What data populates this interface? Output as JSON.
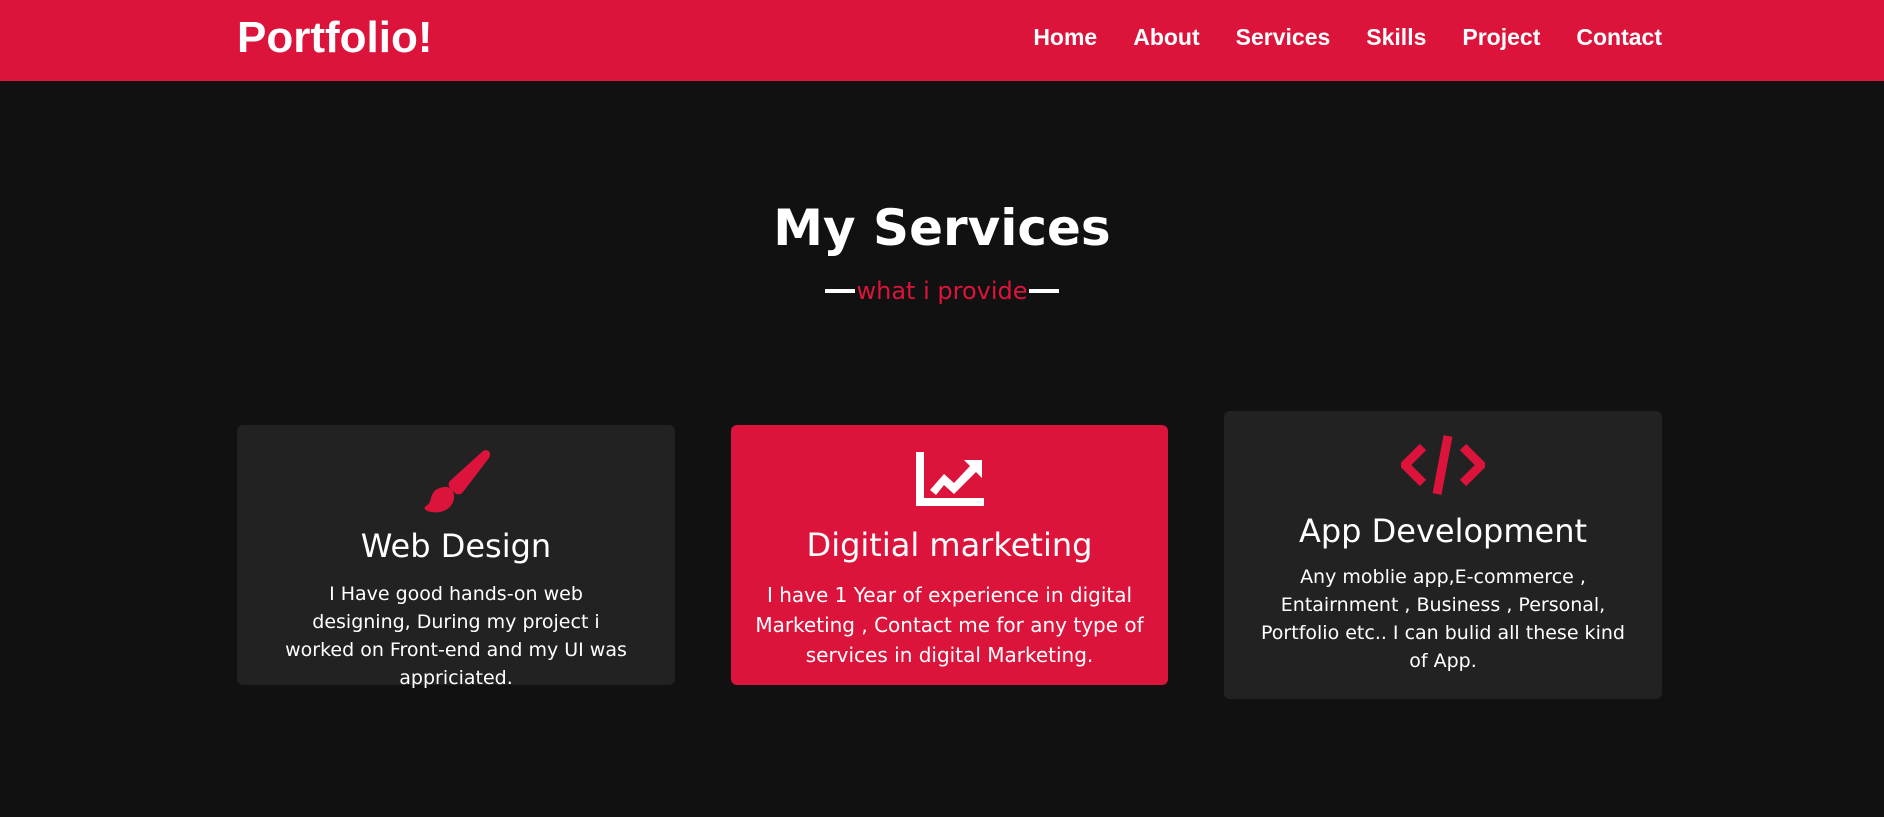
{
  "header": {
    "logo": "Portfolio!",
    "nav": [
      "Home",
      "About",
      "Services",
      "Skills",
      "Project",
      "Contact"
    ]
  },
  "services": {
    "title": "My Services",
    "subtitle": "what i provide",
    "cards": [
      {
        "icon": "paint-brush-icon",
        "title": "Web Design",
        "text": "I Have good hands-on web designing, During my project i worked on Front-end and my UI was appriciated."
      },
      {
        "icon": "chart-line-icon",
        "title": "Digitial marketing",
        "text": "I have 1 Year of experience in digital Marketing , Contact me for any type of services in digital Marketing."
      },
      {
        "icon": "code-icon",
        "title": "App Development",
        "text": "Any moblie app,E-commerce , Entairnment , Business , Personal, Portfolio etc.. I can bulid all these kind of App."
      }
    ]
  },
  "colors": {
    "accent": "#dc143c",
    "background": "#111111",
    "card": "#222222"
  }
}
